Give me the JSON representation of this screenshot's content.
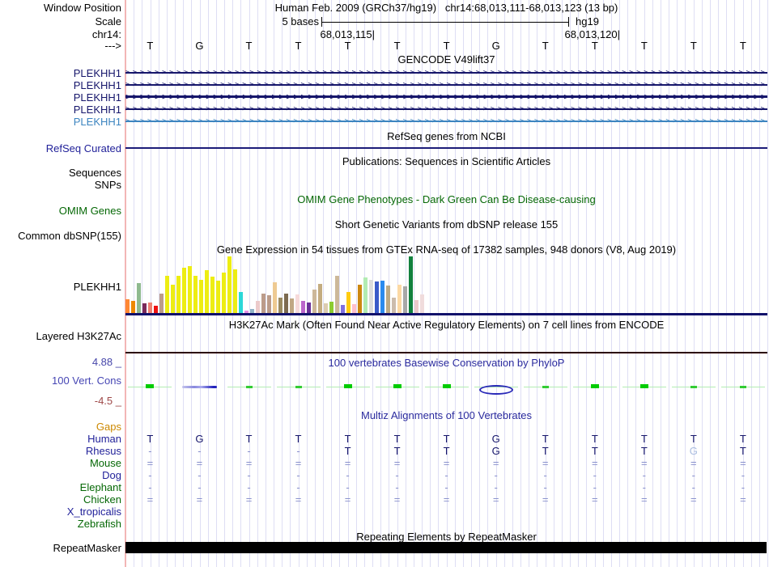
{
  "header": {
    "row1_label": "Window Position",
    "title": "Human Feb. 2009 (GRCh37/hg19)   chr14:68,013,111-68,013,123 (13 bp)",
    "row2_label": "Scale",
    "scale_text": "5 bases",
    "assembly": "hg19",
    "row3_label": "chr14:",
    "pos_left": "68,013,115|",
    "pos_right": "68,013,120|",
    "strand": "--->"
  },
  "ruler": {
    "bases": [
      "T",
      "G",
      "T",
      "T",
      "T",
      "T",
      "T",
      "G",
      "T",
      "T",
      "T",
      "T",
      "T"
    ]
  },
  "gencode": {
    "title": "GENCODE V49lift37",
    "transcripts": [
      {
        "label": "PLEKHH1",
        "color": "#16166b",
        "thick": false
      },
      {
        "label": "PLEKHH1",
        "color": "#16166b",
        "thick": false
      },
      {
        "label": "PLEKHH1",
        "color": "#16166b",
        "thick": true
      },
      {
        "label": "PLEKHH1",
        "color": "#16166b",
        "thick": false
      },
      {
        "label": "PLEKHH1",
        "color": "#3d85c0",
        "thick": false
      }
    ]
  },
  "refseq": {
    "label": "RefSeq Curated",
    "title": "RefSeq genes from NCBI"
  },
  "publications": {
    "title": "Publications: Sequences in Scientific Articles"
  },
  "sequences_label": "Sequences",
  "snps_label": "SNPs",
  "omim": {
    "title": "OMIM Gene Phenotypes - Dark Green Can Be Disease-causing",
    "label": "OMIM Genes"
  },
  "dbsnp": {
    "title": "Short Genetic Variants from dbSNP release 155",
    "label": "Common dbSNP(155)"
  },
  "gtex": {
    "title": "Gene Expression in 54 tissues from GTEx RNA-seq of 17382 samples, 948 donors (V8, Aug 2019)",
    "label": "PLEKHH1",
    "bars": [
      [
        "#ff8833",
        18
      ],
      [
        "#ee8800",
        16
      ],
      [
        "#8fba8f",
        38
      ],
      [
        "#7a2a5a",
        13
      ],
      [
        "#ee7f70",
        14
      ],
      [
        "#ee1111",
        10
      ],
      [
        "#bc9c8a",
        25
      ],
      [
        "#eded13",
        47
      ],
      [
        "#eded13",
        36
      ],
      [
        "#eded13",
        47
      ],
      [
        "#eded13",
        57
      ],
      [
        "#eded13",
        59
      ],
      [
        "#eded13",
        47
      ],
      [
        "#eded13",
        42
      ],
      [
        "#eded13",
        54
      ],
      [
        "#eded13",
        46
      ],
      [
        "#eded13",
        41
      ],
      [
        "#eded13",
        51
      ],
      [
        "#eded13",
        71
      ],
      [
        "#eded13",
        55
      ],
      [
        "#2cd8d8",
        27
      ],
      [
        "#e690e6",
        4
      ],
      [
        "#92b4c8",
        6
      ],
      [
        "#eccaca",
        16
      ],
      [
        "#bc9c8a",
        25
      ],
      [
        "#bc9c8a",
        23
      ],
      [
        "#eeca92",
        39
      ],
      [
        "#9a8a60",
        20
      ],
      [
        "#7c6a50",
        25
      ],
      [
        "#c0a884",
        19
      ],
      [
        "#f6dada",
        24
      ],
      [
        "#bb66cc",
        16
      ],
      [
        "#6a3099",
        14
      ],
      [
        "#cdb89a",
        30
      ],
      [
        "#c4ac80",
        37
      ],
      [
        "#dcccb0",
        13
      ],
      [
        "#8ccc30",
        15
      ],
      [
        "#cdb89a",
        47
      ],
      [
        "#8070e0",
        11
      ],
      [
        "#ffcc11",
        27
      ],
      [
        "#ffc0cc",
        12
      ],
      [
        "#cc8811",
        36
      ],
      [
        "#b2ecb2",
        45
      ],
      [
        "#dcdcdc",
        42
      ],
      [
        "#3a5ac8",
        40
      ],
      [
        "#2a8aee",
        41
      ],
      [
        "#bcaa86",
        35
      ],
      [
        "#ccbcac",
        20
      ],
      [
        "#fcd9a4",
        36
      ],
      [
        "#a8a8a8",
        34
      ],
      [
        "#12813e",
        71
      ],
      [
        "#eccaca",
        17
      ],
      [
        "#f0dcdc",
        24
      ]
    ]
  },
  "h3k27ac": {
    "title": "H3K27Ac Mark (Often Found Near Active Regulatory Elements) on 7 cell lines from ENCODE",
    "label": "Layered H3K27Ac"
  },
  "phylop": {
    "title": "100 vertebrates Basewise Conservation by PhyloP",
    "label": "100 Vert. Cons",
    "max": "4.88 _",
    "min": "-4.5 _",
    "marks": [
      "box",
      "smear",
      "dash",
      "dash",
      "box",
      "box",
      "box",
      "ellipse",
      "dash",
      "box",
      "box",
      "dash",
      "dash"
    ]
  },
  "multiz": {
    "title": "Multiz Alignments of 100 Vertebrates",
    "gaps_label": "Gaps",
    "rows": [
      {
        "label": "Human",
        "label_color": "#22229a",
        "cells": [
          "T",
          "G",
          "T",
          "T",
          "T",
          "T",
          "T",
          "G",
          "T",
          "T",
          "T",
          "T",
          "T"
        ],
        "styles": "LLLLLLLLLLLLL"
      },
      {
        "label": "Rhesus",
        "label_color": "#22229a",
        "cells": [
          "-",
          "-",
          "-",
          "-",
          "T",
          "T",
          "T",
          "G",
          "T",
          "T",
          "T",
          "G",
          "T"
        ],
        "styles": "mmmmLLLLLLLfL"
      },
      {
        "label": "Mouse",
        "label_color": "#066806",
        "cells": [
          "=",
          "=",
          "=",
          "=",
          "=",
          "=",
          "=",
          "=",
          "=",
          "=",
          "=",
          "=",
          "="
        ],
        "styles": "mmmmmmmmmmmmm"
      },
      {
        "label": "Dog",
        "label_color": "#22229a",
        "cells": [
          "-",
          "-",
          "-",
          "-",
          "-",
          "-",
          "-",
          "-",
          "-",
          "-",
          "-",
          "-",
          "-"
        ],
        "styles": "mmmmmmmmmmmmm"
      },
      {
        "label": "Elephant",
        "label_color": "#066806",
        "cells": [
          "-",
          "-",
          "-",
          "-",
          "-",
          "-",
          "-",
          "-",
          "-",
          "-",
          "-",
          "-",
          "-"
        ],
        "styles": "mmmmmmmmmmmmm"
      },
      {
        "label": "Chicken",
        "label_color": "#066806",
        "cells": [
          "=",
          "=",
          "=",
          "=",
          "=",
          "=",
          "=",
          "=",
          "=",
          "=",
          "=",
          "=",
          "="
        ],
        "styles": "mmmmmmmmmmmmm"
      },
      {
        "label": "X_tropicalis",
        "label_color": "#22229a",
        "cells": [],
        "styles": ""
      },
      {
        "label": "Zebrafish",
        "label_color": "#066806",
        "cells": [],
        "styles": ""
      }
    ]
  },
  "repeat": {
    "title": "Repeating Elements by RepeatMasker",
    "label": "RepeatMasker"
  },
  "colors": {
    "navy_line": "#16166b",
    "refseq_line": "#1b1b78",
    "gtex_baseline": "#11116b",
    "h3k_line": "#2b0000",
    "phylop_max": "#4747aa",
    "phylop_min": "#9e4848",
    "grid": "#dedef4",
    "left_border": "#f2b6b6",
    "repeat_bar": "#000000"
  }
}
